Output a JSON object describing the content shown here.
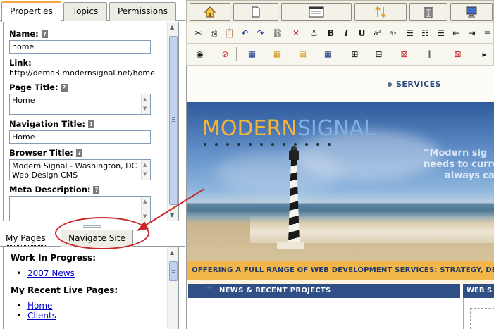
{
  "left_panel": {
    "tabs": [
      {
        "label": "Properties",
        "active": true
      },
      {
        "label": "Topics",
        "active": false
      },
      {
        "label": "Permissions",
        "active": false
      }
    ],
    "help_icon": "?",
    "fields": {
      "name": {
        "label": "Name:",
        "value": "home"
      },
      "link": {
        "label": "Link:",
        "value": "http://demo3.modernsignal.net/home"
      },
      "page_title": {
        "label": "Page Title:",
        "value": "Home"
      },
      "navigation_title": {
        "label": "Navigation Title:",
        "value": "Home"
      },
      "browser_title": {
        "label": "Browser Title:",
        "value": "Modern Signal - Washington, DC Web Design CMS"
      },
      "meta_description": {
        "label": "Meta Description:",
        "value": ""
      }
    },
    "bottom_tabs": [
      {
        "label": "My Pages",
        "active": false
      },
      {
        "label": "Navigate Site",
        "active": true
      }
    ],
    "my_pages": {
      "work_in_progress_heading": "Work In Progress:",
      "work_in_progress": [
        "2007 News"
      ],
      "recent_live_heading": "My Recent Live Pages:",
      "recent_live": [
        "Home",
        "Clients"
      ]
    }
  },
  "toolbar": {
    "row1_icons": [
      "home-icon",
      "new-page-icon",
      "page-properties-icon",
      "move-page-icon",
      "delete-icon",
      "preview-icon"
    ],
    "row2_icons": [
      "cut-icon",
      "copy-icon",
      "paste-icon",
      "undo-icon",
      "redo-icon",
      "link-icon",
      "unlink-icon",
      "anchor-icon",
      "bold-icon",
      "italic-icon",
      "underline-icon",
      "superscript-icon",
      "subscript-icon",
      "horizontal-rule-icon",
      "ordered-list-icon",
      "unordered-list-icon",
      "outdent-icon"
    ],
    "row3_icons": [
      "view-source-icon",
      "no-format-icon",
      "insert-table-icon",
      "table-properties-icon",
      "insert-row-icon",
      "cell-properties-icon",
      "merge-cells-icon",
      "split-cells-icon",
      "delete-cells-icon",
      "insert-column-icon",
      "delete-column-icon"
    ],
    "glyphs": {
      "bold": "B",
      "italic": "I",
      "underline": "U",
      "superscript": "a²",
      "subscript": "a₂"
    }
  },
  "site_preview": {
    "nav_link": "SERVICES",
    "logo_part1": "MODERN",
    "logo_part2": "SIGNAL",
    "quote_line1": "“Modern sig",
    "quote_line2": "needs to curre",
    "quote_line3": "always ca",
    "banner": "OFFERING A FULL RANGE OF WEB DEVELOPMENT SERVICES: STRATEGY, DESIG",
    "news_heading": "NEWS & RECENT PROJECTS",
    "web_heading": "WEB S"
  },
  "colors": {
    "accent_tab": "#f5a442",
    "logo_orange": "#f2b43a",
    "logo_blue": "#7fb0e6",
    "banner_bg": "#f2b64a",
    "nav_bar": "#2f4f86",
    "annotation_red": "#c8282a"
  }
}
